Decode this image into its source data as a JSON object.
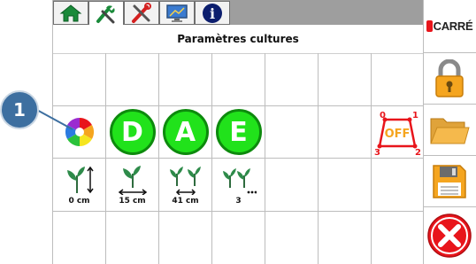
{
  "title": "Paramètres cultures",
  "brand": "CARRÉ",
  "tabs": [
    {
      "icon": "home-icon"
    },
    {
      "icon": "tools-icon"
    },
    {
      "icon": "settings-tools-icon"
    },
    {
      "icon": "monitor-icon"
    },
    {
      "icon": "info-icon",
      "label": "i"
    }
  ],
  "callout": "1",
  "letters": [
    "D",
    "A",
    "E"
  ],
  "off_widget": {
    "label": "OFF",
    "corners": [
      "0",
      "1",
      "3",
      "2"
    ]
  },
  "plants": [
    {
      "icon": "plant-height-icon",
      "value": "0 cm"
    },
    {
      "icon": "plant-spacing-icon",
      "value": "15 cm"
    },
    {
      "icon": "row-spacing-icon",
      "value": "41 cm"
    },
    {
      "icon": "plant-count-icon",
      "value": "3"
    }
  ],
  "colors": {
    "accent_green": "#21e21b",
    "alert_red": "#e8151b",
    "orange": "#f5a51f",
    "tab_bar": "#9e9e9e",
    "badge": "#3d6fa0"
  }
}
